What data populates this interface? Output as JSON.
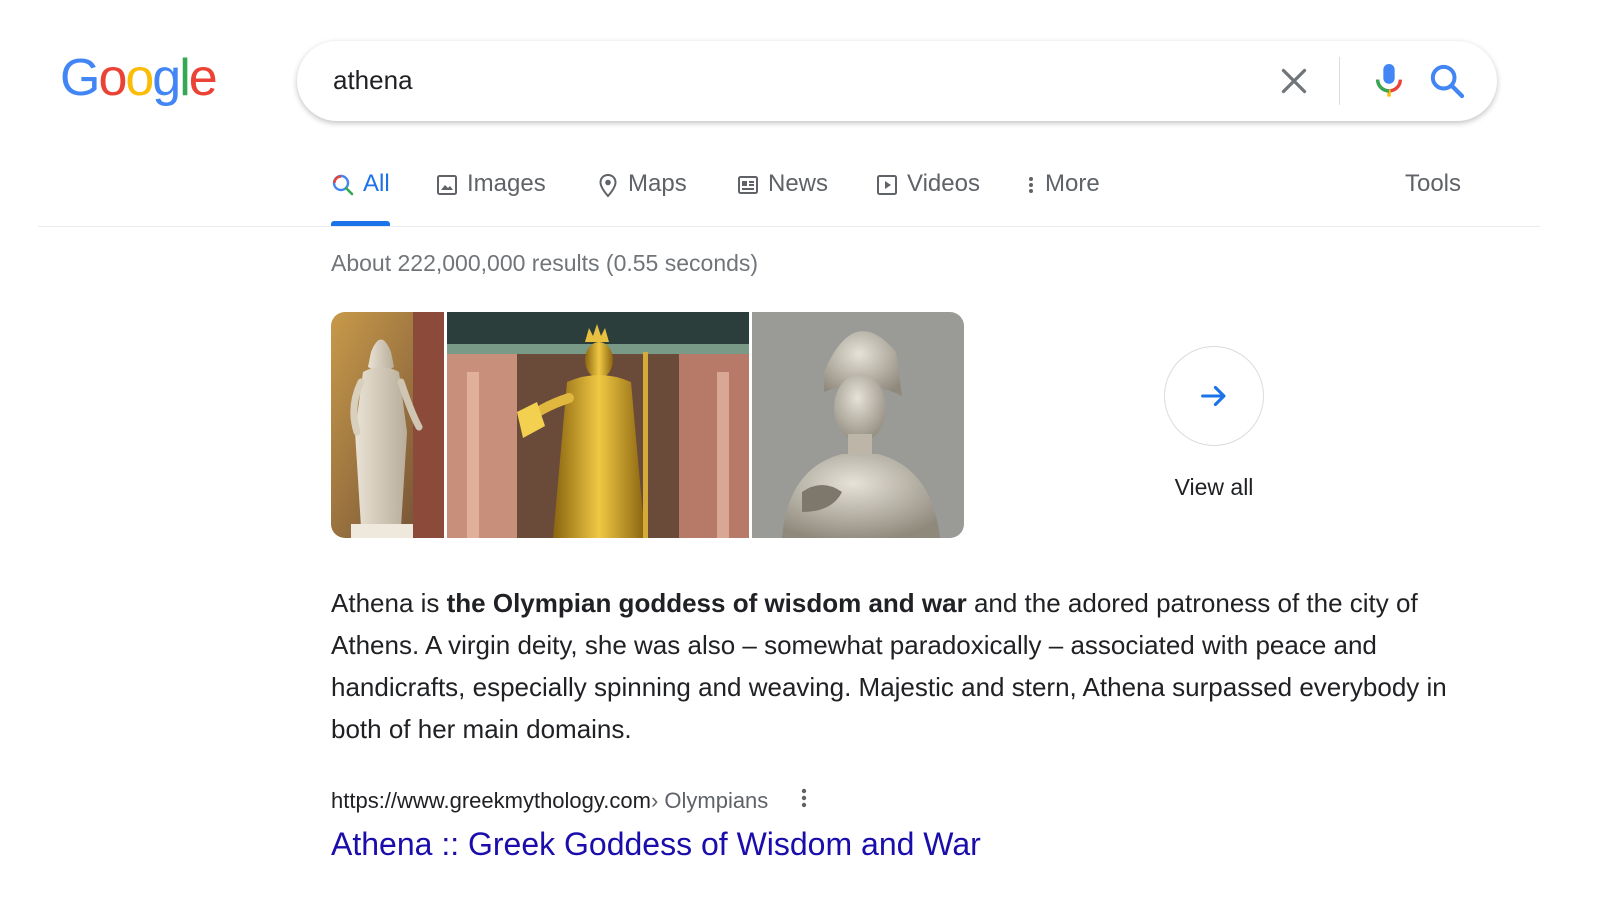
{
  "logo": {
    "letters": [
      "G",
      "o",
      "o",
      "g",
      "l",
      "e"
    ],
    "colors": [
      "#4285f4",
      "#ea4335",
      "#fbbc05",
      "#4285f4",
      "#34a853",
      "#ea4335"
    ]
  },
  "search": {
    "query": "athena"
  },
  "tabs": [
    {
      "label": "All",
      "icon": "search-icon",
      "active": true
    },
    {
      "label": "Images",
      "icon": "image-icon"
    },
    {
      "label": "Maps",
      "icon": "map-pin-icon"
    },
    {
      "label": "News",
      "icon": "news-icon"
    },
    {
      "label": "Videos",
      "icon": "video-icon"
    },
    {
      "label": "More",
      "icon": "more-vertical-icon"
    }
  ],
  "tools_label": "Tools",
  "stats": "About 222,000,000 results (0.55 seconds)",
  "images": [
    {
      "name": "athena-statue-standing-image"
    },
    {
      "name": "athena-parthenos-golden-statue-image"
    },
    {
      "name": "athena-marble-bust-image"
    }
  ],
  "view_all_label": "View all",
  "snippet": {
    "pre": "Athena is ",
    "bold": "the Olympian goddess of wisdom and war",
    "post": " and the adored patroness of the city of Athens. A virgin deity, she was also – somewhat paradoxically – associated with peace and handicrafts, especially spinning and weaving. Majestic and stern, Athena surpassed everybody in both of her main domains."
  },
  "result": {
    "url": "https://www.greekmythology.com",
    "breadcrumb": " › Olympians",
    "title": "Athena :: Greek Goddess of Wisdom and War"
  },
  "colors": {
    "accent": "#1a73e8",
    "link": "#1a0dab",
    "muted": "#5f6368"
  }
}
